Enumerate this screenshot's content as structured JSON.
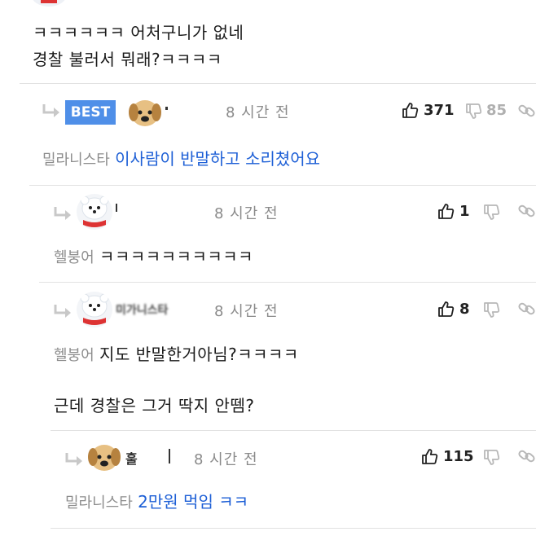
{
  "top_comment": {
    "line1": "ㅋㅋㅋㅋㅋㅋ 어처구니가 없네",
    "line2": "경찰 불러서 뭐래?ㅋㅋㅋㅋ"
  },
  "replies": [
    {
      "badge": "BEST",
      "time": "8 시간 전",
      "likes": "371",
      "dislikes": "85",
      "mention": "밀라니스타",
      "text": "이사람이 반말하고 소리쳤어요"
    },
    {
      "time": "8 시간 전",
      "likes": "1",
      "mention": "헬붕어",
      "text": "ㅋㅋㅋㅋㅋㅋㅋㅋㅋㅋ"
    },
    {
      "nickname": "미가니스타",
      "time": "8 시간 전",
      "likes": "8",
      "mention": "헬붕어",
      "text": "지도 반말한거아님?ㅋㅋㅋㅋ",
      "text2": "근데 경찰은 그거 딱지 안뗌?"
    },
    {
      "nickname": "훌",
      "time": "8 시간 전",
      "likes": "115",
      "mention": "밀라니스타",
      "text": "2만원 먹임 ㅋㅋ"
    }
  ],
  "icons": {
    "reply": "reply-arrow-icon",
    "like": "thumbs-up-icon",
    "dislike": "thumbs-down-icon",
    "share": "link-icon"
  },
  "colors": {
    "best_badge": "#4f8fe8",
    "mention_text": "#1d5fd6"
  }
}
